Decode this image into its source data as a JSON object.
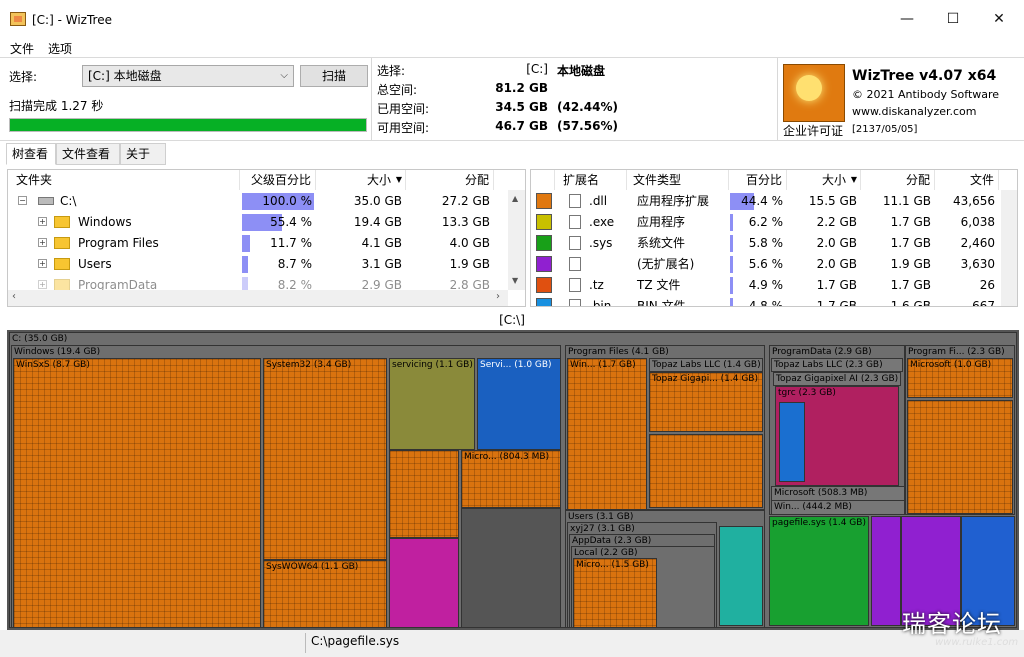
{
  "window": {
    "title": "[C:]  - WizTree",
    "minimize": "—",
    "maximize": "☐",
    "close": "✕"
  },
  "menu": {
    "file": "文件",
    "options": "选项"
  },
  "scan": {
    "select_label": "选择:",
    "drive_value": "[C:] 本地磁盘",
    "scan_button": "扫描",
    "status": "扫描完成 1.27 秒",
    "progress": 100
  },
  "stats": {
    "selected_label": "选择:",
    "selected_drive": "[C:]",
    "selected_name": "本地磁盘",
    "total_label": "总空间:",
    "total_value": "81.2 GB",
    "used_label": "已用空间:",
    "used_value": "34.5 GB",
    "used_pct": "(42.44%)",
    "free_label": "可用空间:",
    "free_value": "46.7 GB",
    "free_pct": "(57.56%)"
  },
  "about": {
    "product": "WizTree v4.07 x64",
    "copyright": "© 2021 Antibody Software",
    "website": "www.diskanalyzer.com",
    "license": "企业许可证",
    "license_date": "[2137/05/05]"
  },
  "tabs": [
    "树查看",
    "文件查看",
    "关于"
  ],
  "tree": {
    "headers": {
      "folder": "文件夹",
      "parent_pct": "父级百分比",
      "size": "大小",
      "allocated": "分配"
    },
    "rows": [
      {
        "name": "C:\\",
        "pct": "100.0 %",
        "pct_val": 100,
        "size": "35.0 GB",
        "alloc": "27.2 GB"
      },
      {
        "name": "Windows",
        "pct": "55.4 %",
        "pct_val": 55.4,
        "size": "19.4 GB",
        "alloc": "13.3 GB"
      },
      {
        "name": "Program Files",
        "pct": "11.7 %",
        "pct_val": 11.7,
        "size": "4.1 GB",
        "alloc": "4.0 GB"
      },
      {
        "name": "Users",
        "pct": "8.7 %",
        "pct_val": 8.7,
        "size": "3.1 GB",
        "alloc": "1.9 GB"
      },
      {
        "name": "ProgramData",
        "pct": "8.2 %",
        "pct_val": 8.2,
        "size": "2.9 GB",
        "alloc": "2.8 GB"
      }
    ],
    "expand_minus": "−",
    "expand_plus": "+"
  },
  "ext": {
    "headers": {
      "ext": "扩展名",
      "type": "文件类型",
      "pct": "百分比",
      "size": "大小",
      "allocated": "分配",
      "files": "文件"
    },
    "rows": [
      {
        "color": "#e07810",
        "ext": ".dll",
        "type": "应用程序扩展",
        "pct": "44.4 %",
        "pct_val": 44.4,
        "size": "15.5 GB",
        "alloc": "11.1 GB",
        "files": "43,656"
      },
      {
        "color": "#c8c000",
        "ext": ".exe",
        "type": "应用程序",
        "pct": "6.2 %",
        "pct_val": 6.2,
        "size": "2.2 GB",
        "alloc": "1.7 GB",
        "files": "6,038"
      },
      {
        "color": "#18a018",
        "ext": ".sys",
        "type": "系统文件",
        "pct": "5.8 %",
        "pct_val": 5.8,
        "size": "2.0 GB",
        "alloc": "1.7 GB",
        "files": "2,460"
      },
      {
        "color": "#9020d0",
        "ext": "",
        "type": "(无扩展名)",
        "pct": "5.6 %",
        "pct_val": 5.6,
        "size": "2.0 GB",
        "alloc": "1.9 GB",
        "files": "3,630"
      },
      {
        "color": "#e05010",
        "ext": ".tz",
        "type": "TZ 文件",
        "pct": "4.9 %",
        "pct_val": 4.9,
        "size": "1.7 GB",
        "alloc": "1.7 GB",
        "files": "26"
      },
      {
        "color": "#1890e0",
        "ext": ".bin",
        "type": "BIN 文件",
        "pct": "4.8 %",
        "pct_val": 4.8,
        "size": "1.7 GB",
        "alloc": "1.6 GB",
        "files": "667"
      }
    ]
  },
  "treemap": {
    "path": "[C:\\]",
    "labels": {
      "c": "C: (35.0 GB)",
      "windows": "Windows (19.4 GB)",
      "winsxs": "WinSxS (8.7 GB)",
      "system32": "System32 (3.4 GB)",
      "servicing": "servicing (1.1 GB)",
      "servi": "Servi... (1.0 GB)",
      "micro1": "Micro... (804.3 MB)",
      "syswow64": "SysWOW64 (1.1 GB)",
      "programfiles": "Program Files (4.1 GB)",
      "win": "Win... (1.7 GB)",
      "topaz1": "Topaz Labs LLC (1.4 GB)",
      "topaz_gigapi": "Topaz Gigapi... (1.4 GB)",
      "users": "Users (3.1 GB)",
      "xyj27": "xyj27 (3.1 GB)",
      "appdata": "AppData (2.3 GB)",
      "local": "Local (2.2 GB)",
      "micro2": "Micro... (1.5 GB)",
      "programdata": "ProgramData (2.9 GB)",
      "topaz2": "Topaz Labs LLC (2.3 GB)",
      "topaz_gigapixel": "Topaz Gigapixel AI (2.3 GB)",
      "tgrc": "tgrc (2.3 GB)",
      "microsoft1": "Microsoft (508.3 MB)",
      "win2": "Win... (444.2 MB)",
      "programfi": "Program Fi... (2.3 GB)",
      "microsoft2": "Microsoft (1.0 GB)",
      "pagefile": "pagefile.sys (1.4 GB)"
    }
  },
  "status": {
    "path": "C:\\pagefile.sys"
  },
  "watermark": {
    "text": "瑞客论坛",
    "url": "www.ruike1.com"
  },
  "colors": {
    "orange": "#d9730f",
    "progress": "#06b025",
    "pct_bar": "#8d8ff5"
  }
}
